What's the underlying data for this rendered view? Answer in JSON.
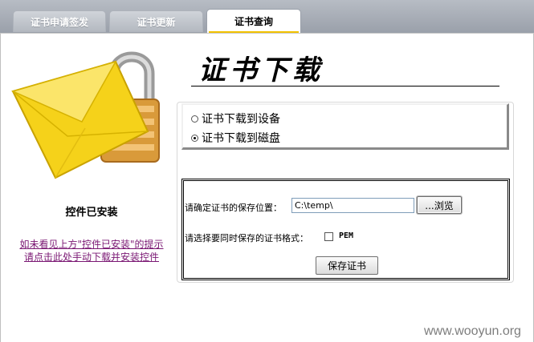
{
  "tabs": [
    {
      "label": "证书申请签发",
      "active": false
    },
    {
      "label": "证书更新",
      "active": false
    },
    {
      "label": "证书查询",
      "active": true
    }
  ],
  "left_panel": {
    "status_text": "控件已安装",
    "help_link_line1": "如未看见上方\"控件已安装\"的提示",
    "help_link_line2": "请点击此处手动下载并安装控件"
  },
  "main": {
    "title": "证书下载",
    "radio_options": [
      {
        "label": "证书下载到设备",
        "checked": false
      },
      {
        "label": "证书下载到磁盘",
        "checked": true
      }
    ],
    "form": {
      "location_label": "请确定证书的保存位置：",
      "location_value": "C:\\temp\\",
      "browse_label": "...浏览",
      "format_label": "请选择要同时保存的证书格式：",
      "pem_label": "PEM",
      "pem_checked": false,
      "save_label": "保存证书"
    }
  },
  "watermark": "www.wooyun.org",
  "colors": {
    "tab_bar": "#9aa0aa",
    "active_tab_accent": "#f2c200",
    "link": "#7a1773",
    "envelope": "#f5d21a",
    "lock": "#d99a3a"
  },
  "icons": {
    "envelope_lock": "envelope-lock-icon"
  }
}
